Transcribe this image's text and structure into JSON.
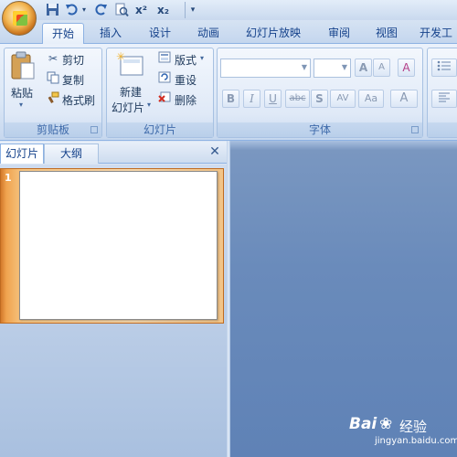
{
  "quick_access": {
    "save_icon": "save-icon",
    "undo_icon": "undo-icon",
    "redo_icon": "redo-icon",
    "print_preview_icon": "print-preview-icon",
    "superscript": "x²",
    "subscript": "x₂",
    "more_icon": "▾"
  },
  "tabs": {
    "home": "开始",
    "insert": "插入",
    "design": "设计",
    "animation": "动画",
    "slideshow": "幻灯片放映",
    "review": "审阅",
    "view": "视图",
    "developer": "开发工"
  },
  "clipboard": {
    "paste": "粘贴",
    "cut": "剪切",
    "copy": "复制",
    "format_painter": "格式刷",
    "label": "剪贴板"
  },
  "slides_group": {
    "new_slide_line1": "新建",
    "new_slide_line2": "幻灯片",
    "layout": "版式",
    "reset": "重设",
    "delete": "删除",
    "label": "幻灯片"
  },
  "font_group": {
    "label": "字体",
    "grow": "A",
    "shrink": "A",
    "clear": "A",
    "bold": "B",
    "italic": "I",
    "underline": "U",
    "strike": "abc",
    "shadow": "S",
    "spacing": "AV",
    "case": "Aa",
    "color": "A"
  },
  "side_pane": {
    "tab_slides": "幻灯片",
    "tab_outline": "大纲",
    "close": "✕",
    "slide_number": "1"
  },
  "watermark": {
    "brand": "Bai",
    "paw": "❀",
    "cn": "经验",
    "url": "jingyan.baidu.com"
  }
}
